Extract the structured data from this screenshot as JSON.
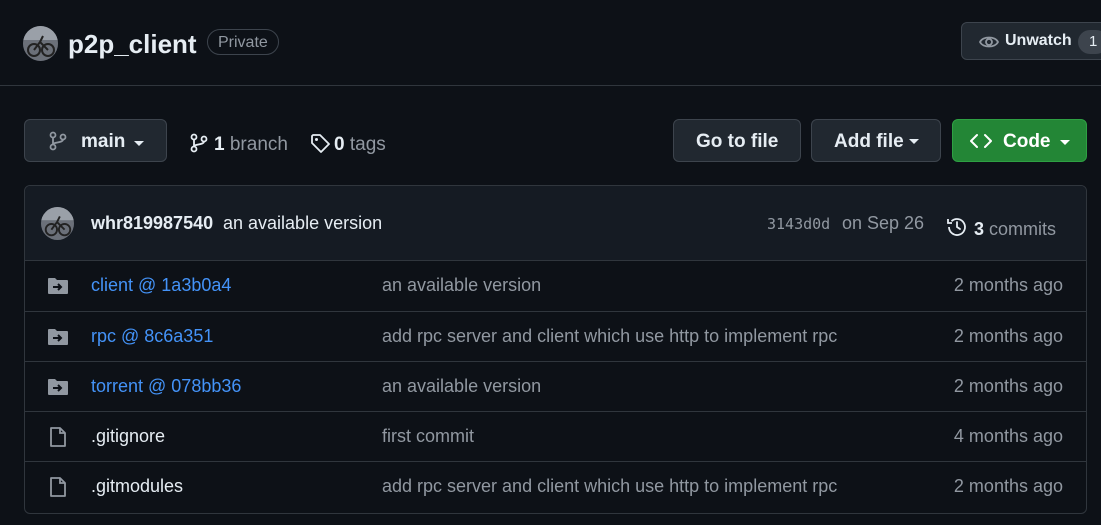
{
  "header": {
    "repo_name": "p2p_client",
    "visibility_badge": "Private",
    "unwatch_label": "Unwatch",
    "watch_count": "1"
  },
  "toolbar": {
    "branch_label": "main",
    "branches_count": "1",
    "branches_text": "branch",
    "tags_count": "0",
    "tags_text": "tags",
    "goto_file_label": "Go to file",
    "add_file_label": "Add file",
    "code_label": "Code"
  },
  "latest_commit": {
    "author": "whr819987540",
    "message": "an available version",
    "sha": "3143d0d",
    "date": "on Sep 26",
    "commits_count": "3",
    "commits_text": "commits"
  },
  "files": [
    {
      "name": "client @ 1a3b0a4",
      "type": "submodule",
      "message": "an available version",
      "age": "2 months ago"
    },
    {
      "name": "rpc @ 8c6a351",
      "type": "submodule",
      "message": "add rpc server and client which use http to implement rpc",
      "age": "2 months ago"
    },
    {
      "name": "torrent @ 078bb36",
      "type": "submodule",
      "message": "an available version",
      "age": "2 months ago"
    },
    {
      "name": ".gitignore",
      "type": "file",
      "message": "first commit",
      "age": "4 months ago"
    },
    {
      "name": ".gitmodules",
      "type": "file",
      "message": "add rpc server and client which use http to implement rpc",
      "age": "2 months ago"
    }
  ],
  "colors": {
    "background": "#0d1117",
    "link": "#4493f8",
    "code_button": "#238636",
    "border": "#30363d"
  }
}
